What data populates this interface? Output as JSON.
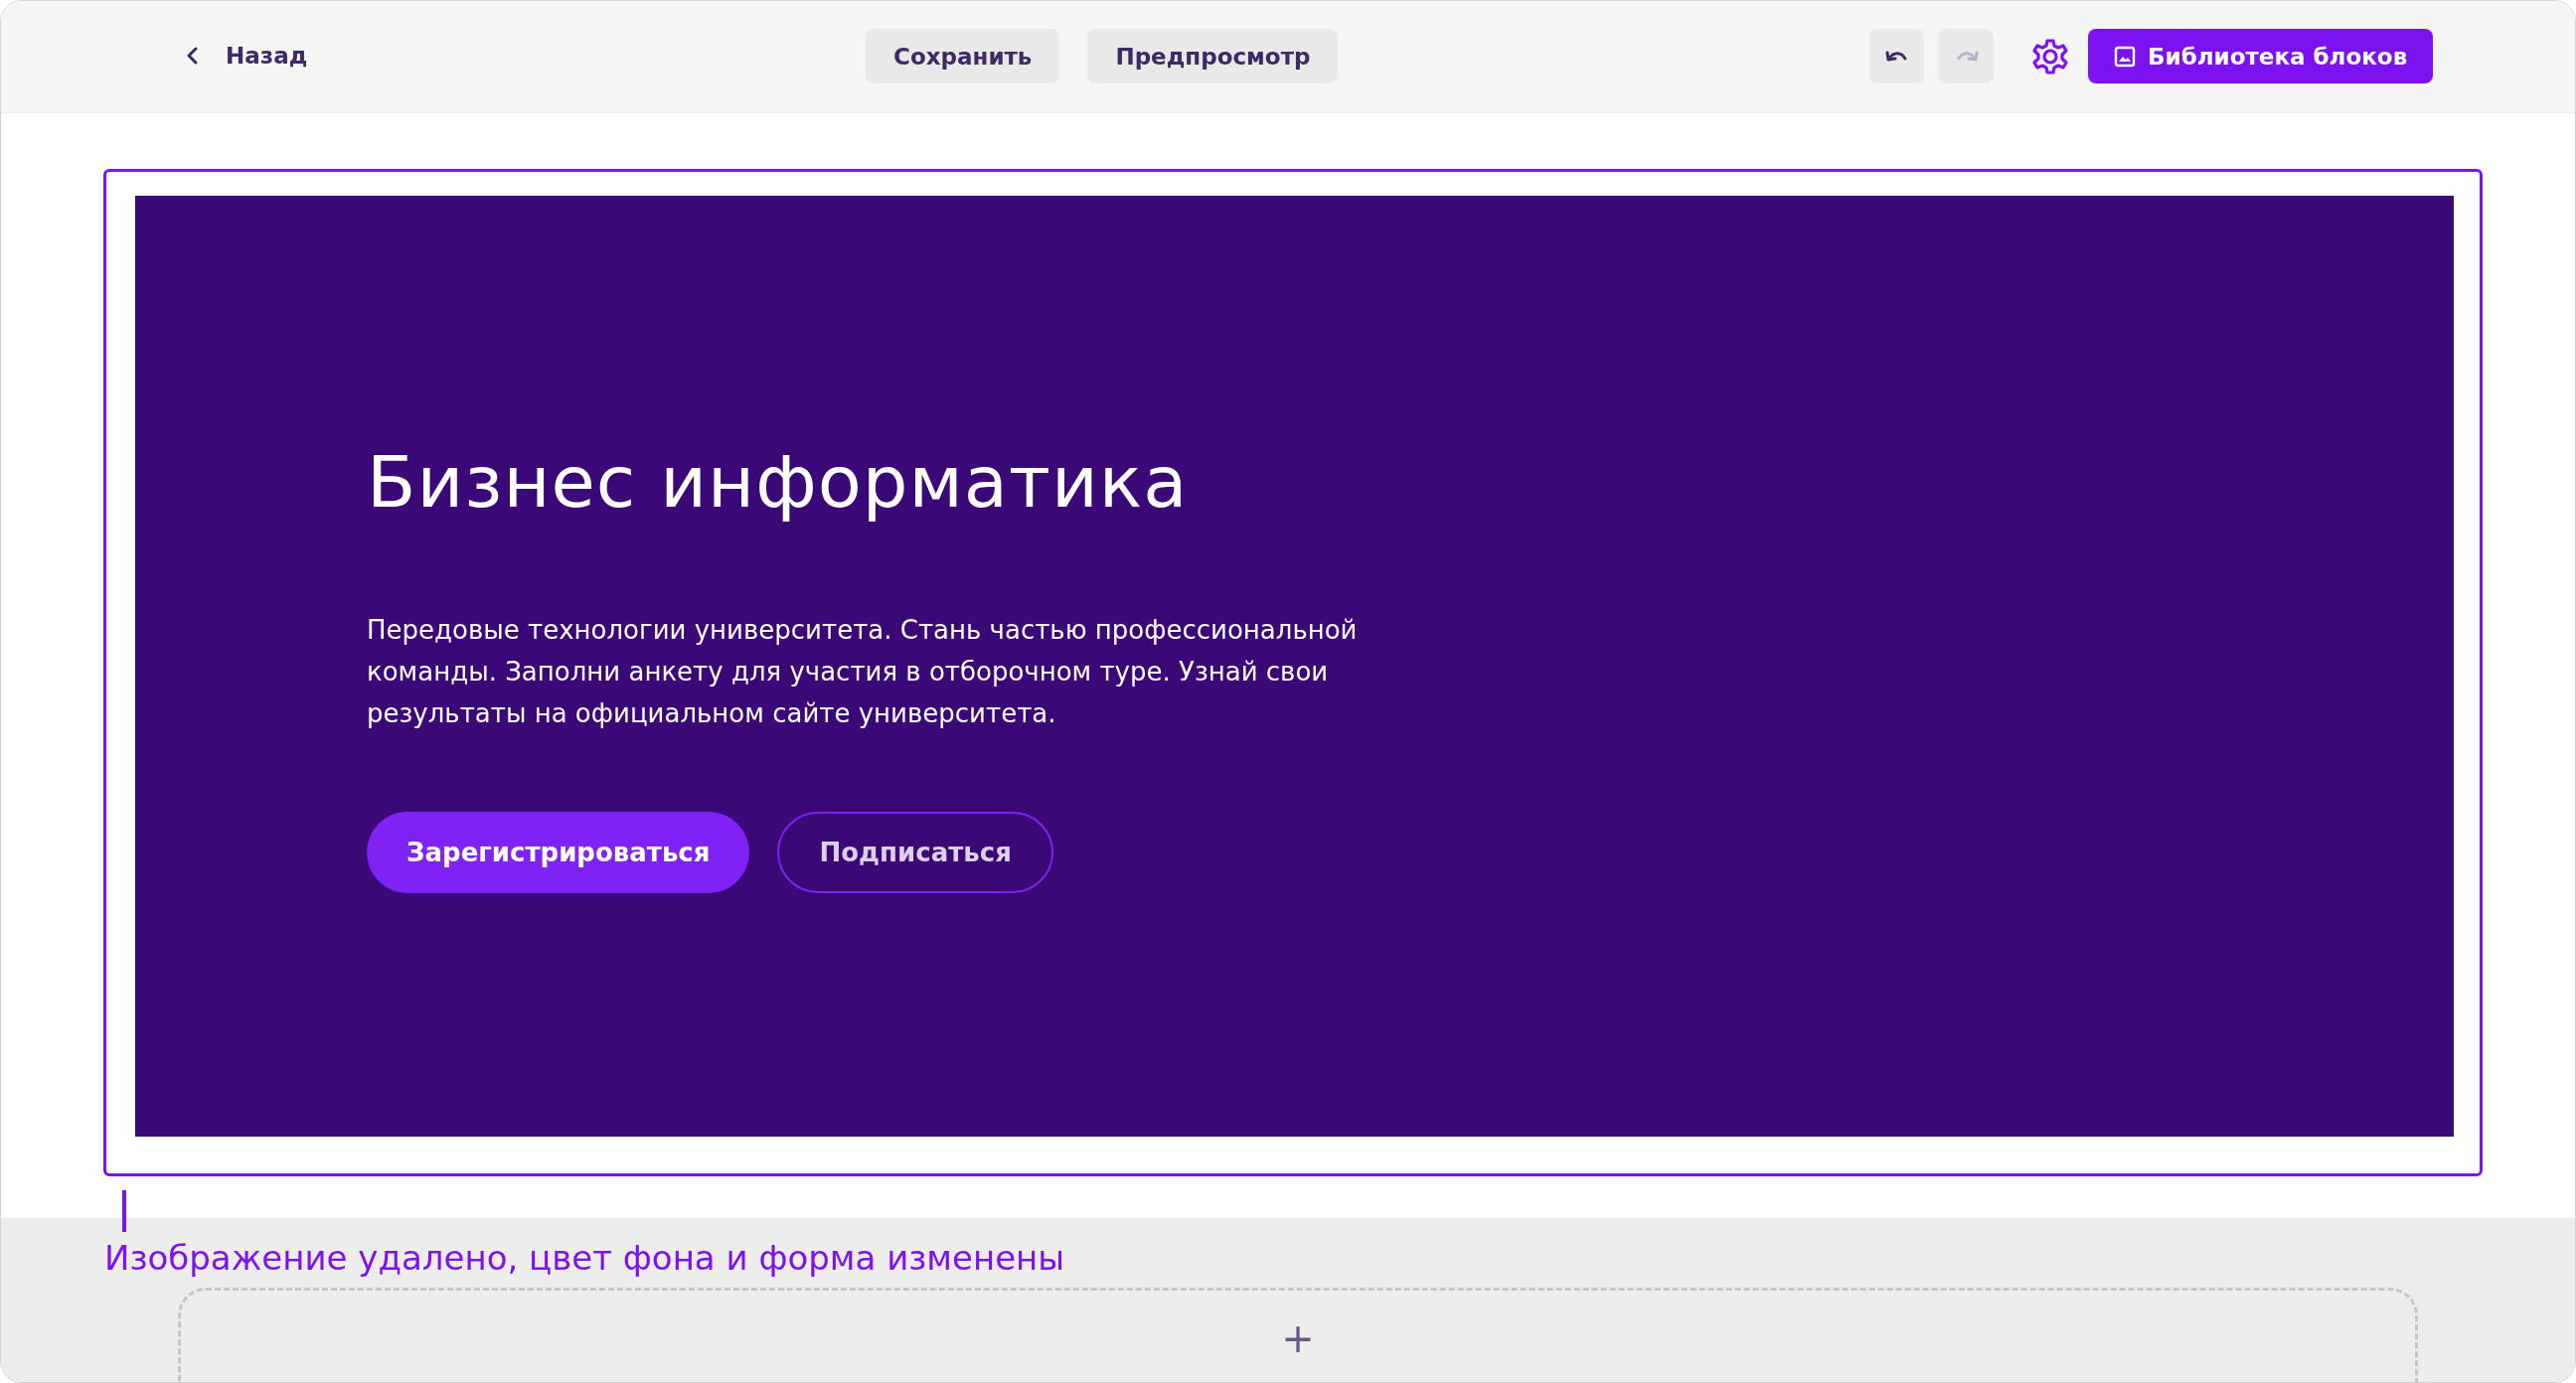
{
  "toolbar": {
    "back": "Назад",
    "save": "Сохранить",
    "preview": "Предпросмотр",
    "history": [
      {
        "kind": "undo",
        "disabled": false
      },
      {
        "kind": "redo",
        "disabled": true
      }
    ],
    "library": "Библиотека блоков"
  },
  "hero": {
    "title": "Бизнес информатика",
    "text": "Передовые технологии университета. Стань частью профессиональной команды. Заполни анкету для участия в отборочном туре. Узнай свои результаты на официальном сайте университета.",
    "buttons": [
      {
        "label": "Зарегистрироваться",
        "kind": "primary"
      },
      {
        "label": "Подписаться",
        "kind": "outline"
      }
    ]
  },
  "caption": "Изображение удалено, цвет фона и форма изменены",
  "add_block": "+"
}
